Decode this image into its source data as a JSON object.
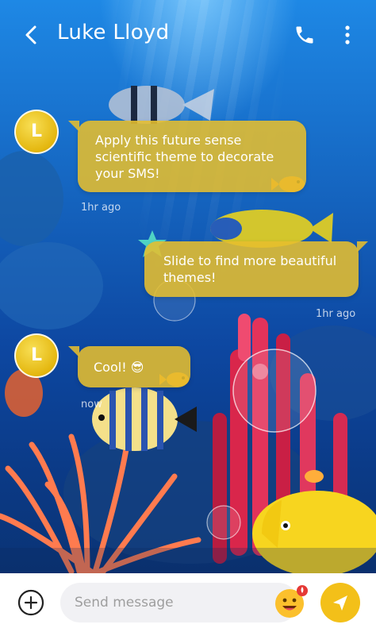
{
  "header": {
    "contact_name": "Luke Lloyd",
    "back_icon": "chevron-left-icon",
    "call_icon": "phone-icon",
    "menu_icon": "more-vertical-icon"
  },
  "messages": [
    {
      "direction": "incoming",
      "avatar_letter": "L",
      "text": "Apply this future sense scientific theme to decorate your SMS!",
      "time": "1hr ago"
    },
    {
      "direction": "outgoing",
      "text": "Slide to find more beautiful themes!",
      "time": "1hr ago"
    },
    {
      "direction": "incoming",
      "avatar_letter": "L",
      "text": "Cool! 😎",
      "time": "now"
    }
  ],
  "composer": {
    "placeholder": "Send message",
    "add_icon": "plus-circle-icon",
    "emoji_icon": "emoji-icon",
    "send_icon": "send-icon"
  },
  "colors": {
    "accent": "#f3c019",
    "bubble": "#e6be2d"
  }
}
